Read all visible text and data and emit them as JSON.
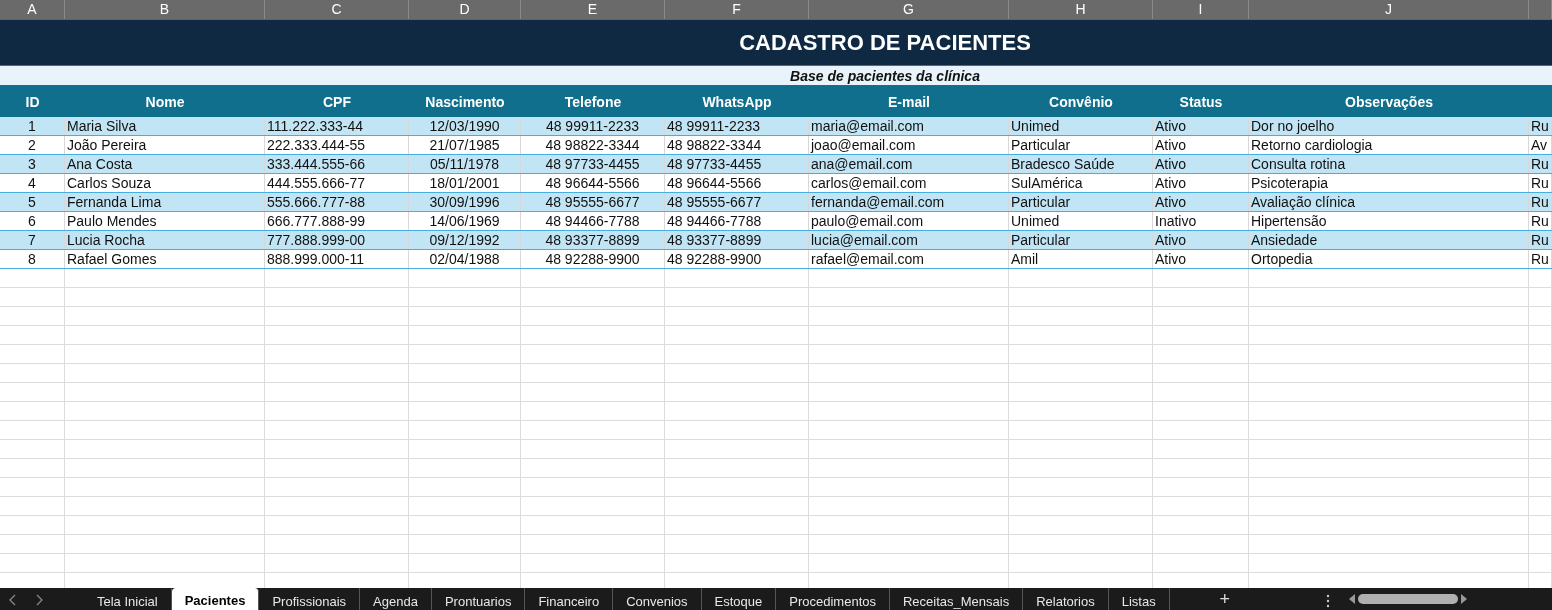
{
  "column_letters": [
    "A",
    "B",
    "C",
    "D",
    "E",
    "F",
    "G",
    "H",
    "I",
    "J"
  ],
  "title": "CADASTRO DE PACIENTES",
  "subtitle": "Base de pacientes da clínica",
  "columns": [
    "ID",
    "Nome",
    "CPF",
    "Nascimento",
    "Telefone",
    "WhatsApp",
    "E-mail",
    "Convênio",
    "Status",
    "Observações"
  ],
  "rows": [
    {
      "cells": [
        "1",
        "Maria Silva",
        "111.222.333-44",
        "12/03/1990",
        "48 99911-2233",
        "48 99911-2233",
        "maria@email.com",
        "Unimed",
        "Ativo",
        "Dor no joelho",
        "Ru"
      ]
    },
    {
      "cells": [
        "2",
        "João Pereira",
        "222.333.444-55",
        "21/07/1985",
        "48 98822-3344",
        "48 98822-3344",
        "joao@email.com",
        "Particular",
        "Ativo",
        "Retorno cardiologia",
        "Av"
      ]
    },
    {
      "cells": [
        "3",
        "Ana Costa",
        "333.444.555-66",
        "05/11/1978",
        "48 97733-4455",
        "48 97733-4455",
        "ana@email.com",
        "Bradesco Saúde",
        "Ativo",
        "Consulta rotina",
        "Ru"
      ]
    },
    {
      "cells": [
        "4",
        "Carlos Souza",
        "444.555.666-77",
        "18/01/2001",
        "48 96644-5566",
        "48 96644-5566",
        "carlos@email.com",
        "SulAmérica",
        "Ativo",
        "Psicoterapia",
        "Ru"
      ]
    },
    {
      "cells": [
        "5",
        "Fernanda Lima",
        "555.666.777-88",
        "30/09/1996",
        "48 95555-6677",
        "48 95555-6677",
        "fernanda@email.com",
        "Particular",
        "Ativo",
        "Avaliação clínica",
        "Ru"
      ]
    },
    {
      "cells": [
        "6",
        "Paulo Mendes",
        "666.777.888-99",
        "14/06/1969",
        "48 94466-7788",
        "48 94466-7788",
        "paulo@email.com",
        "Unimed",
        "Inativo",
        "Hipertensão",
        "Ru"
      ]
    },
    {
      "cells": [
        "7",
        "Lucia Rocha",
        "777.888.999-00",
        "09/12/1992",
        "48 93377-8899",
        "48 93377-8899",
        "lucia@email.com",
        "Particular",
        "Ativo",
        "Ansiedade",
        "Ru"
      ]
    },
    {
      "cells": [
        "8",
        "Rafael Gomes",
        "888.999.000-11",
        "02/04/1988",
        "48 92288-9900",
        "48 92288-9900",
        "rafael@email.com",
        "Amil",
        "Ativo",
        "Ortopedia",
        "Ru"
      ]
    }
  ],
  "tabs": [
    {
      "label": "Tela Inicial",
      "selected": false
    },
    {
      "label": "Pacientes",
      "selected": true
    },
    {
      "label": "Profissionais",
      "selected": false
    },
    {
      "label": "Agenda",
      "selected": false
    },
    {
      "label": "Prontuarios",
      "selected": false
    },
    {
      "label": "Financeiro",
      "selected": false
    },
    {
      "label": "Convenios",
      "selected": false
    },
    {
      "label": "Estoque",
      "selected": false
    },
    {
      "label": "Procedimentos",
      "selected": false
    },
    {
      "label": "Receitas_Mensais",
      "selected": false
    },
    {
      "label": "Relatorios",
      "selected": false
    },
    {
      "label": "Listas",
      "selected": false
    }
  ],
  "add_sheet": "+"
}
